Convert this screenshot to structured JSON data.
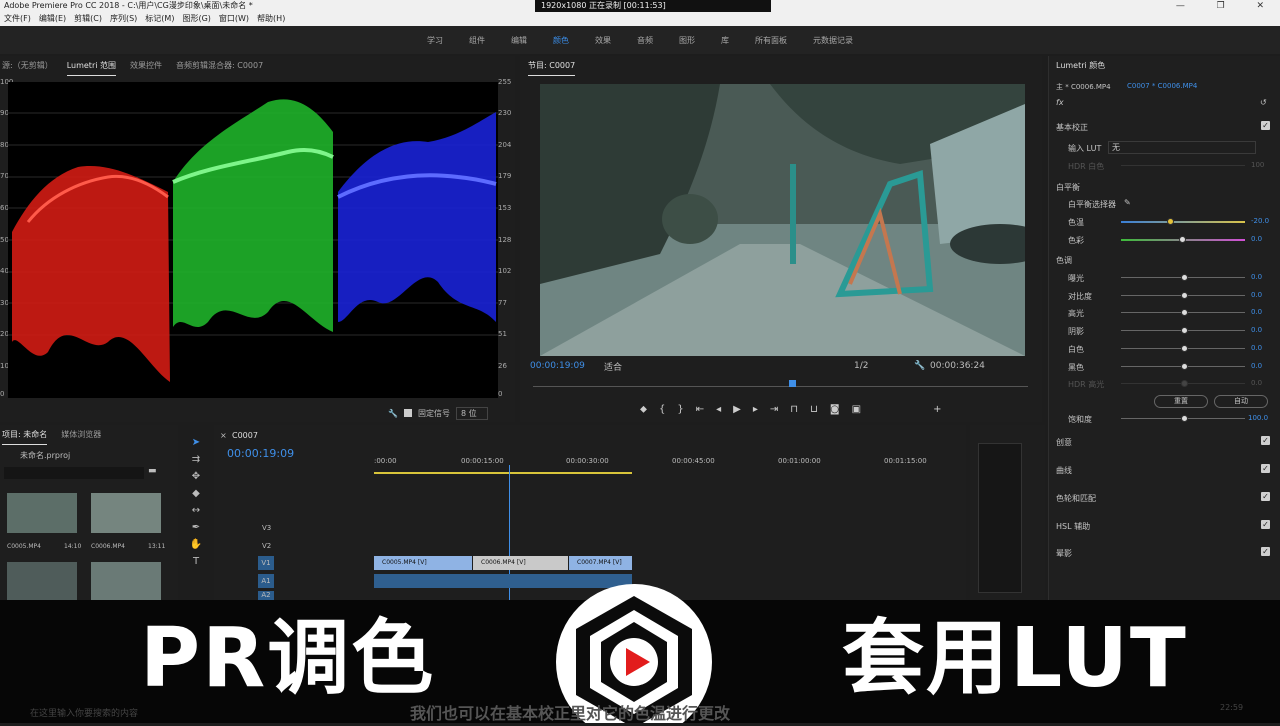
{
  "app": {
    "title": "Adobe Premiere Pro CC 2018 - C:\\用户\\CG漫步印象\\桌面\\未命名 *"
  },
  "recorder": {
    "text": "1920x1080  正在录制 [00:11:53]"
  },
  "menu": [
    "文件(F)",
    "编辑(E)",
    "剪辑(C)",
    "序列(S)",
    "标记(M)",
    "图形(G)",
    "窗口(W)",
    "帮助(H)"
  ],
  "workspaces": [
    "学习",
    "组件",
    "编辑",
    "颜色",
    "效果",
    "音频",
    "图形",
    "库",
    "所有面板",
    "元数据记录"
  ],
  "active_workspace": "颜色",
  "scopes": {
    "tabs": [
      "源:（无剪辑）",
      "Lumetri 范围",
      "效果控件",
      "音频剪辑混合器: C0007"
    ],
    "left_axis": [
      "100",
      "90",
      "80",
      "70",
      "60",
      "50",
      "40",
      "30",
      "20",
      "10",
      "0"
    ],
    "right_axis": [
      "255",
      "230",
      "204",
      "179",
      "153",
      "128",
      "102",
      "77",
      "51",
      "26",
      "0"
    ],
    "fixed_signal": "固定信号",
    "bit_depth": "8 位"
  },
  "program": {
    "title": "节目: C0007",
    "timecode": "00:00:19:09",
    "fit": "适合",
    "resolution": "1/2",
    "duration": "00:00:36:24"
  },
  "lumetri": {
    "title": "Lumetri 颜色",
    "master": "主 * C0006.MP4",
    "clip": "C0007 * C0006.MP4",
    "basic_correction": "基本校正",
    "input_lut_label": "输入 LUT",
    "input_lut_value": "无",
    "hdr_white": "HDR 白色",
    "hdr_white_value": "100",
    "white_balance": "白平衡",
    "wb_selector": "白平衡选择器",
    "temperature": {
      "label": "色温",
      "value": "-20.0",
      "level": 0.4
    },
    "tint": {
      "label": "色彩",
      "value": "0.0",
      "level": 0.5
    },
    "tone": "色调",
    "tone_rows": [
      {
        "label": "曝光",
        "value": "0.0"
      },
      {
        "label": "对比度",
        "value": "0.0"
      },
      {
        "label": "高光",
        "value": "0.0"
      },
      {
        "label": "阴影",
        "value": "0.0"
      },
      {
        "label": "白色",
        "value": "0.0"
      },
      {
        "label": "黑色",
        "value": "0.0"
      },
      {
        "label": "HDR 高光",
        "value": "0.0"
      }
    ],
    "reset": "重置",
    "auto": "自动",
    "saturation": {
      "label": "饱和度",
      "value": "100.0"
    },
    "sections": [
      "创意",
      "曲线",
      "色轮和匹配",
      "HSL 辅助",
      "晕影"
    ]
  },
  "project": {
    "tabs": [
      "项目: 未命名",
      "媒体浏览器"
    ],
    "file": "未命名.prproj",
    "clips": [
      {
        "name": "C0005.MP4",
        "duration": "14:10"
      },
      {
        "name": "C0006.MP4",
        "duration": "13:11"
      }
    ]
  },
  "timeline": {
    "sequence": "C0007",
    "timecode": "00:00:19:09",
    "ruler": [
      ":00:00",
      "00:00:15:00",
      "00:00:30:00",
      "00:00:45:00",
      "00:01:00:00",
      "00:01:15:00"
    ],
    "tracks": [
      "V3",
      "V2",
      "V1",
      "A1",
      "A2"
    ],
    "clips": [
      "C0005.MP4 [V]",
      "C0006.MP4 [V]",
      "C0007.MP4 [V]"
    ]
  },
  "banner": {
    "left": "PR调色",
    "right": "套用LUT",
    "subtitle": "我们也可以在基本校正里对它的色温进行更改"
  },
  "taskbar": {
    "search_placeholder": "在这里输入你要搜索的内容",
    "time": "22:59"
  }
}
